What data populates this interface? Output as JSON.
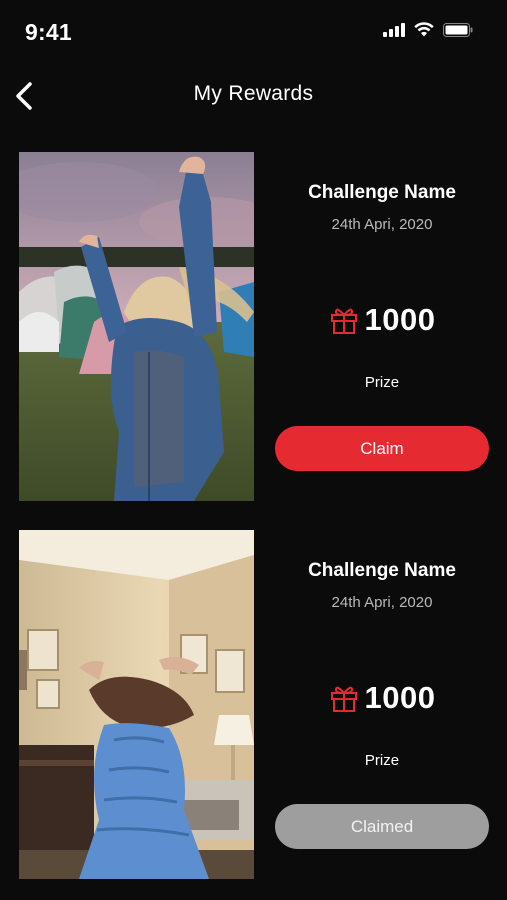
{
  "status_bar": {
    "time": "9:41"
  },
  "header": {
    "title": "My Rewards"
  },
  "rewards": [
    {
      "challenge_name": "Challenge Name",
      "date": "24th Apri, 2020",
      "prize_amount": "1000",
      "prize_label": "Prize",
      "button_label": "Claim",
      "status": "claimable"
    },
    {
      "challenge_name": "Challenge Name",
      "date": "24th Apri, 2020",
      "prize_amount": "1000",
      "prize_label": "Prize",
      "button_label": "Claimed",
      "status": "claimed"
    }
  ],
  "colors": {
    "accent": "#e52a31",
    "background": "#0b0b0b",
    "claimed_button": "#9e9e9e",
    "secondary_text": "#b9b9b9"
  }
}
